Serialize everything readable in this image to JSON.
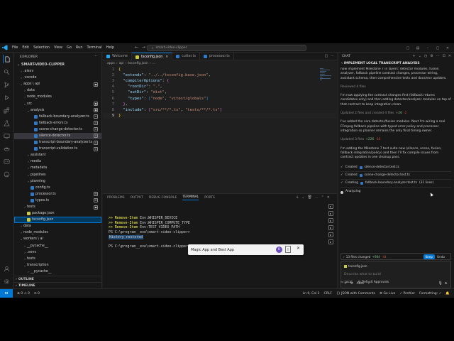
{
  "titlebar": {
    "menu": [
      "File",
      "Edit",
      "Selection",
      "View",
      "Go",
      "Run",
      "Terminal",
      "Help"
    ],
    "search": "smart-video-clipper"
  },
  "explorer": {
    "header": "EXPLORER",
    "project": "SMART-VIDEO-CLIPPER",
    "items": [
      {
        "label": ".aiexv",
        "depth": 1,
        "type": "folder",
        "open": false
      },
      {
        "label": ".vscode",
        "depth": 1,
        "type": "folder",
        "open": false
      },
      {
        "label": "apps \\ api",
        "depth": 1,
        "type": "folder",
        "open": true,
        "badge": "●"
      },
      {
        "label": "data",
        "depth": 2,
        "type": "folder",
        "open": false
      },
      {
        "label": "node_modules",
        "depth": 2,
        "type": "folder",
        "open": false
      },
      {
        "label": "src",
        "depth": 2,
        "type": "folder",
        "open": true,
        "badge": "●"
      },
      {
        "label": "analysis",
        "depth": 3,
        "type": "folder",
        "open": true,
        "badge": "●"
      },
      {
        "label": "fallback-boundary-analyzer.ts",
        "depth": 4,
        "type": "ts",
        "badge": "U"
      },
      {
        "label": "fallback-errors.ts",
        "depth": 4,
        "type": "ts",
        "badge": "U"
      },
      {
        "label": "scene-change-detector.ts",
        "depth": 4,
        "type": "ts",
        "badge": "U"
      },
      {
        "label": "silence-detector.ts",
        "depth": 4,
        "type": "ts",
        "badge": "U",
        "selected": true
      },
      {
        "label": "transcript-boundary-analyzer.ts",
        "depth": 4,
        "type": "ts",
        "badge": "U"
      },
      {
        "label": "transcript-validation.ts",
        "depth": 4,
        "type": "ts",
        "badge": "U"
      },
      {
        "label": "assistant",
        "depth": 3,
        "type": "folder",
        "open": false
      },
      {
        "label": "media",
        "depth": 3,
        "type": "folder",
        "open": false
      },
      {
        "label": "metadata",
        "depth": 3,
        "type": "folder",
        "open": false
      },
      {
        "label": "pipelines",
        "depth": 3,
        "type": "folder",
        "open": false
      },
      {
        "label": "planning",
        "depth": 3,
        "type": "folder",
        "open": false
      },
      {
        "label": "config.ts",
        "depth": 3,
        "type": "ts"
      },
      {
        "label": "processor.ts",
        "depth": 3,
        "type": "ts",
        "badge": "M"
      },
      {
        "label": "types.ts",
        "depth": 3,
        "type": "ts",
        "badge": "M"
      },
      {
        "label": "tests",
        "depth": 2,
        "type": "folder",
        "open": false,
        "badge": "●"
      },
      {
        "label": "package.json",
        "depth": 2,
        "type": "json"
      },
      {
        "label": "tsconfig.json",
        "depth": 2,
        "type": "json",
        "active": true
      },
      {
        "label": "data",
        "depth": 1,
        "type": "folder",
        "open": false
      },
      {
        "label": "node_modules",
        "depth": 1,
        "type": "folder",
        "open": false
      },
      {
        "label": "workers \\ ai",
        "depth": 1,
        "type": "folder",
        "open": true
      },
      {
        "label": "__pycache__",
        "depth": 2,
        "type": "folder",
        "open": false
      },
      {
        "label": ".venv",
        "depth": 2,
        "type": "folder",
        "open": false
      },
      {
        "label": "tests",
        "depth": 2,
        "type": "folder",
        "open": false
      },
      {
        "label": "transcription",
        "depth": 2,
        "type": "folder",
        "open": true
      },
      {
        "label": "__pycache__",
        "depth": 3,
        "type": "folder",
        "open": false
      }
    ],
    "footer": [
      "OUTLINE",
      "TIMELINE"
    ]
  },
  "editor": {
    "tabs": [
      {
        "label": "Welcome",
        "icon": "vscode-icon",
        "active": false
      },
      {
        "label": "tsconfig.json",
        "icon": "json",
        "active": true
      },
      {
        "label": "cutter.ts",
        "icon": "ts",
        "active": false
      },
      {
        "label": "processor.ts",
        "icon": "ts",
        "active": false
      }
    ],
    "breadcrumb": [
      "apps",
      "api",
      "tsconfig.json",
      "..."
    ],
    "lines": [
      {
        "n": "1",
        "tokens": [
          [
            "p",
            "{"
          ]
        ]
      },
      {
        "n": "2",
        "tokens": [
          [
            "k",
            "  \"extends\""
          ],
          [
            "c",
            ": "
          ],
          [
            "s",
            "\"../../tsconfig.base.json\""
          ],
          [
            "c",
            ","
          ]
        ]
      },
      {
        "n": "3",
        "tokens": [
          [
            "k",
            "  \"compilerOptions\""
          ],
          [
            "c",
            ": "
          ],
          [
            "p2",
            "{"
          ]
        ]
      },
      {
        "n": "4",
        "tokens": [
          [
            "k",
            "    \"rootDir\""
          ],
          [
            "c",
            ": "
          ],
          [
            "s",
            "\".\""
          ],
          [
            "c",
            ","
          ]
        ]
      },
      {
        "n": "5",
        "tokens": [
          [
            "k",
            "    \"outDir\""
          ],
          [
            "c",
            ": "
          ],
          [
            "s",
            "\"dist\""
          ],
          [
            "c",
            ","
          ]
        ]
      },
      {
        "n": "6",
        "tokens": [
          [
            "k",
            "    \"types\""
          ],
          [
            "c",
            ": "
          ],
          [
            "p3",
            "["
          ],
          [
            "s",
            "\"node\""
          ],
          [
            "c",
            ", "
          ],
          [
            "s",
            "\"vitest/globals\""
          ],
          [
            "p3",
            "]"
          ]
        ]
      },
      {
        "n": "7",
        "tokens": [
          [
            "p2",
            "  }"
          ],
          [
            "c",
            ","
          ]
        ]
      },
      {
        "n": "8",
        "tokens": [
          [
            "k",
            "  \"include\""
          ],
          [
            "c",
            ": "
          ],
          [
            "p2",
            "["
          ],
          [
            "s",
            "\"src/**/*.ts\""
          ],
          [
            "c",
            ", "
          ],
          [
            "s",
            "\"tests/**/*.ts\""
          ],
          [
            "p2",
            "]"
          ]
        ]
      },
      {
        "n": "9",
        "tokens": [
          [
            "p",
            "}"
          ]
        ],
        "current": true
      }
    ]
  },
  "panel": {
    "tabs": [
      "PROBLEMS",
      "OUTPUT",
      "DEBUG CONSOLE",
      "TERMINAL",
      "PORTS"
    ],
    "active_tab": "TERMINAL",
    "terminal": [
      [
        [
          "cmd",
          ">> Remove-Item "
        ],
        [
          "arg",
          "Env:WHISPER_DEVICE"
        ]
      ],
      [
        [
          "cmd",
          ">> Remove-Item "
        ],
        [
          "arg",
          "Env:WHISPER_COMPUTE_TYPE"
        ]
      ],
      [
        [
          "cmd",
          ">> Remove-Item "
        ],
        [
          "arg",
          "Env:TEST_VIDEO_PATH"
        ]
      ],
      [
        [
          "arg",
          "PS C:\\program__exe\\smart-video-clipper> "
        ]
      ],
      [
        [
          "hl",
          "History restored"
        ]
      ],
      [
        [
          "arg",
          " "
        ]
      ],
      [
        [
          "arg",
          "PS C:\\program__exe\\smart-video-clipper> "
        ]
      ]
    ]
  },
  "chat": {
    "header": "CHAT",
    "title": "IMPLEMENT LOCAL TRANSCRIPT ANALYSIS",
    "messages": [
      {
        "type": "para",
        "text": "now implement Milestone 7 in layers: detector modules, fusion analyzer, fallback pipeline contract changes, processor wiring, assistant schema, then comprehensive tests and docs/env updates."
      },
      {
        "type": "meta",
        "text": "Reviewed 4 files"
      },
      {
        "type": "para",
        "text": "I'm now applying the contract changes first (fallback returns candidates-only) and then adding detector/analyzer modules on top of that contract to keep integration clean."
      },
      {
        "type": "meta",
        "text": "Updated 2 files and created 4 files",
        "add": "+26",
        "del": "-2"
      },
      {
        "type": "para",
        "text": "I've added the core detector/fusion modules. Next I'm wiring a real FFmpeg fallback pipeline with typed error policy and processor integration so planner remains the only final timing owner."
      },
      {
        "type": "meta",
        "text": "Updated 3 files",
        "add": "+226",
        "del": "-35"
      },
      {
        "type": "para",
        "text": "I'm adding the Milestone 7 test suite now (silence, scene, fusion, fallback integration/policy) and then I'll fix compile issues from contract updates in one cleanup pass."
      }
    ],
    "created": [
      {
        "label": "Created",
        "file": "silence-detector.test.ts",
        "extra": ""
      },
      {
        "label": "Created",
        "file": "scene-change-detector.test.ts",
        "extra": ""
      },
      {
        "label": "Creating",
        "file": "fallback-boundary-analyzer.test.ts",
        "extra": "(31 lines)"
      }
    ],
    "analyzing": "Analyzing",
    "changes": {
      "text": "13 files changed",
      "add": "+984",
      "del": "-44",
      "keep": "Keep",
      "undo": "Undo"
    },
    "context_file": "tsconfig.json",
    "input_placeholder": "Describe what to build",
    "mode": "Auto",
    "sub_footer": [
      "Local",
      "Default Approvals"
    ]
  },
  "statusbar": {
    "left": [
      "⊗ 0 ⚠ 0",
      "⊙ 0"
    ],
    "right": [
      "CRLF",
      "{} JSON with Comments",
      "⚙ Go Live",
      "✓ Prettier",
      "Formatting: ✓"
    ],
    "position": "Ln 9, Col 2"
  },
  "toast": {
    "text": "Magic App and Best App",
    "avatar": "K"
  },
  "colors": {
    "accent": "#0078d4",
    "bg": "#1f1f1f",
    "sidebar": "#181818"
  }
}
